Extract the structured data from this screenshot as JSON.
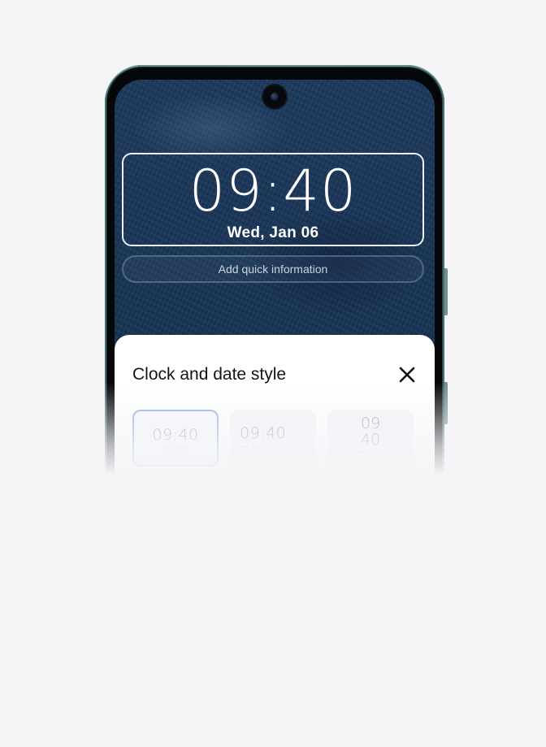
{
  "lock_screen": {
    "time": "09:40",
    "date": "Wed,  Jan 06",
    "quick_info_label": "Add quick information"
  },
  "sheet": {
    "title": "Clock and date style",
    "close_icon": "close-icon",
    "styles": [
      {
        "time": "09:40",
        "date": "Wed, Jan 06",
        "selected": true
      },
      {
        "time": "09:40",
        "date": "Wed, Jan 06",
        "selected": false
      },
      {
        "hour": "09",
        "minute": "40",
        "date": "Wed, Jan 06",
        "selected": false
      }
    ]
  },
  "colors": {
    "page_background": "#f5f5f8",
    "wallpaper": "#1a3557",
    "selected_border": "#8aa4e8",
    "sheet_background": "#ffffff"
  }
}
